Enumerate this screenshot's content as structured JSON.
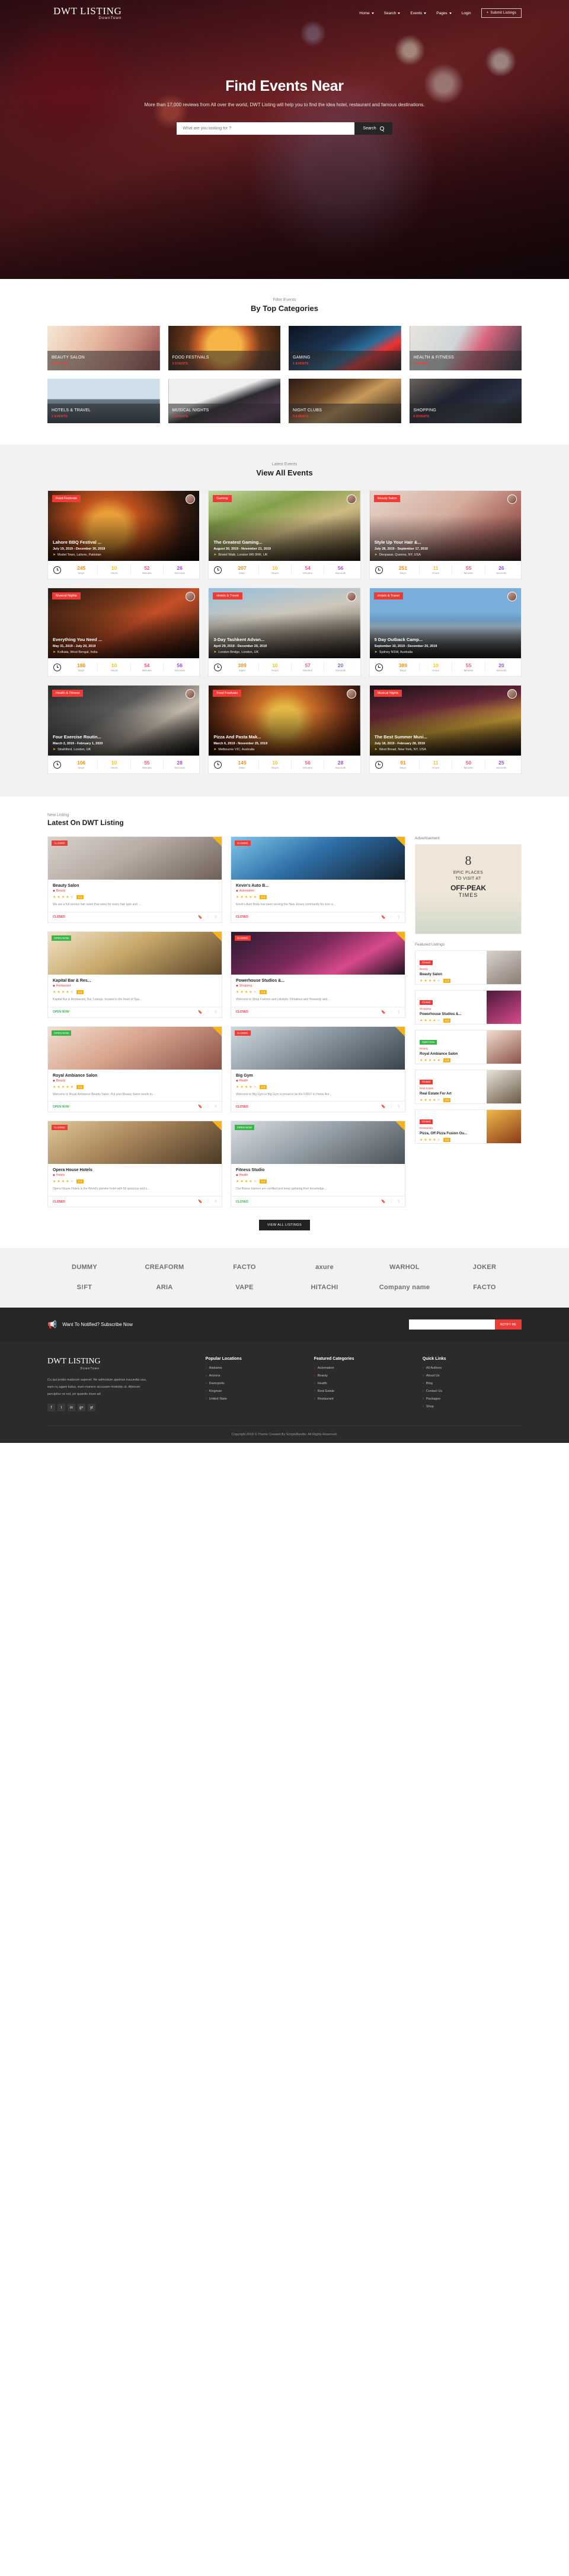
{
  "brand": {
    "title": "DWT LISTING",
    "subtitle": "DownTown",
    "accent": "#ef3b36"
  },
  "nav": {
    "items": [
      {
        "label": "Home",
        "caret": true
      },
      {
        "label": "Search",
        "caret": true
      },
      {
        "label": "Events",
        "caret": true
      },
      {
        "label": "Pages",
        "caret": true
      },
      {
        "label": "Login",
        "caret": false
      }
    ],
    "submit_label": "Submit Listings",
    "submit_icon": "plus-icon"
  },
  "hero": {
    "title": "Find Events Near",
    "subtitle": "More than 17,000 reviews from All over the world, DWT Listing will help you to find the idea hotel, restaurant and famous destinations.",
    "search_placeholder": "What are you looking for ?",
    "search_button": "Search",
    "search_icon": "search-icon"
  },
  "categories": {
    "sub": "Filter Events",
    "title": "By Top Categories",
    "items": [
      {
        "name": "BEAUTY SALON",
        "count": "1 EVENTS",
        "img": "c1"
      },
      {
        "name": "FOOD FESTIVALS",
        "count": "2 EVENTS",
        "img": "c2"
      },
      {
        "name": "GAMING",
        "count": "1 EVENTS",
        "img": "c3"
      },
      {
        "name": "HEALTH & FITNESS",
        "count": "1 EVENTS",
        "img": "c4"
      },
      {
        "name": "HOTELS & TRAVEL",
        "count": "2 EVENTS",
        "img": "c5"
      },
      {
        "name": "MUSICAL NIGHTS",
        "count": "2 EVENTS",
        "img": "c6"
      },
      {
        "name": "NIGHT CLUBS",
        "count": "0 EVENTS",
        "img": "c7"
      },
      {
        "name": "SHOPPING",
        "count": "0 EVENTS",
        "img": "c8"
      }
    ]
  },
  "events": {
    "sub": "Latest Events",
    "title": "View All Events",
    "labels": {
      "days": "Days",
      "hours": "Hours",
      "minutes": "Minutes",
      "seconds": "Seconds"
    },
    "items": [
      {
        "tag": "Food Festivals",
        "title": "Lahore BBQ Festival ...",
        "date": "July 19, 2019 - December 30, 2019",
        "loc": "Model Town, Lahore, Pakistan",
        "days": "245",
        "hours": "10",
        "minutes": "52",
        "seconds": "26",
        "img": "m1"
      },
      {
        "tag": "Gaming",
        "title": "The Greatest Gaming...",
        "date": "August 30, 2019 - November 21, 2019",
        "loc": "Bristol Walk, London W6 0RR, UK",
        "days": "207",
        "hours": "10",
        "minutes": "54",
        "seconds": "56",
        "img": "m2"
      },
      {
        "tag": "Beauty Salon",
        "title": "Style Up Your Hair &...",
        "date": "July 28, 2019 - September 17, 2019",
        "loc": "Denpasar, Queens, NY, USA",
        "days": "251",
        "hours": "11",
        "minutes": "55",
        "seconds": "26",
        "img": "m3"
      },
      {
        "tag": "Musical Nights",
        "title": "Everything You Need ...",
        "date": "May 31, 2019 - July 20, 2019",
        "loc": "Kolkata, West Bengal, India",
        "days": "180",
        "hours": "10",
        "minutes": "54",
        "seconds": "56",
        "img": "m4"
      },
      {
        "tag": "Hotels & Travel",
        "title": "3-Day Tashkent Advan...",
        "date": "April 29, 2019 - December 20, 2019",
        "loc": "London Bridge, London, UK",
        "days": "389",
        "hours": "10",
        "minutes": "57",
        "seconds": "20",
        "img": "m5"
      },
      {
        "tag": "Hotels & Travel",
        "title": "5 Day Outback Camp...",
        "date": "September 10, 2019 - December 20, 2019",
        "loc": "Sydney NSW, Australia",
        "days": "389",
        "hours": "10",
        "minutes": "55",
        "seconds": "20",
        "img": "m6"
      },
      {
        "tag": "Health & Fitness",
        "title": "Four Exercise Routin...",
        "date": "March 2, 2019 - February 1, 2020",
        "loc": "Strathford, London, UK",
        "days": "106",
        "hours": "10",
        "minutes": "55",
        "seconds": "28",
        "img": "m7"
      },
      {
        "tag": "Food Festivals",
        "title": "Pizza And Pasta Mak...",
        "date": "March 6, 2019 - November 25, 2019",
        "loc": "Melbourne VIC, Australia",
        "days": "145",
        "hours": "10",
        "minutes": "56",
        "seconds": "28",
        "img": "m8"
      },
      {
        "tag": "Musical Nights",
        "title": "The Best Summer Musi...",
        "date": "July 18, 2019 - February 28, 2019",
        "loc": "West Broad, New York, NY, USA",
        "days": "91",
        "hours": "11",
        "minutes": "50",
        "seconds": "25",
        "img": "m9"
      }
    ]
  },
  "latest": {
    "sub": "New Listing",
    "title": "Latest On DWT Listing",
    "ad_head": "Advertisement",
    "featured_head": "Featured Listings",
    "view_all": "VIEW ALL LISTINGS",
    "cards": [
      {
        "badge": "CLOSED",
        "badge_type": "closed",
        "title": "Beauty Salon",
        "cat": "Beauty",
        "desc": "We are a full service hair salon that cares for every hair type and ...",
        "rating": "4.3",
        "stars": 4,
        "status": "CLOSED",
        "img": "l1"
      },
      {
        "badge": "CLOSED",
        "badge_type": "closed",
        "title": "Kevin's Auto B...",
        "cat": "Automation",
        "desc": "Kevin's Auto Body has been serving the New Jersey community for over a...",
        "rating": "5.0",
        "stars": 5,
        "status": "CLOSED",
        "img": "l2"
      },
      {
        "badge": "OPEN NOW",
        "badge_type": "open",
        "title": "Kapital Bar & Res...",
        "cat": "Restaurant",
        "desc": "Kapital Bar & Restaurant, Bar, Lounge, located in the heart of Spa...",
        "rating": "4.0",
        "stars": 4,
        "status": "OPEN NOW",
        "img": "l3"
      },
      {
        "badge": "CLOSED",
        "badge_type": "closed",
        "title": "Powerhouse Studios &...",
        "cat": "Shopping",
        "desc": "Welcome to Shop Fashion and Lifestyle: Flirtatious and Heavenly and...",
        "rating": "4.5",
        "stars": 4,
        "status": "CLOSED",
        "img": "l4"
      },
      {
        "badge": "OPEN NOW",
        "badge_type": "open",
        "title": "Royal Ambiance Salon",
        "cat": "Beauty",
        "desc": "Welcome to Royal Ambiance Beauty Salon. Put your Beauty Salon needs in...",
        "rating": "4.8",
        "stars": 5,
        "status": "OPEN NOW",
        "img": "l5"
      },
      {
        "badge": "CLOSED",
        "badge_type": "closed",
        "title": "Big Gym",
        "cat": "Health",
        "desc": "Welcome to Big Gym in Big Gym is proud to be the FIRST in Home Are...",
        "rating": "4.0",
        "stars": 4,
        "status": "CLOSED",
        "img": "l6"
      },
      {
        "badge": "CLOSED",
        "badge_type": "closed",
        "title": "Opera House Hotels",
        "cat": "Hotels",
        "desc": "Opera House Hotels is the World's premier hotel with 50 spacious and s...",
        "rating": "3.8",
        "stars": 4,
        "status": "CLOSED",
        "img": "l7"
      },
      {
        "badge": "OPEN NOW",
        "badge_type": "open",
        "title": "Fitness Studio",
        "cat": "Health",
        "desc": "Our fitness trainers are certified and keep updating their knowledge...",
        "rating": "4.5",
        "stars": 4,
        "status": "CLOSED",
        "img": "l8"
      }
    ],
    "ad": {
      "num": "8",
      "l1": "EPIC PLACES",
      "l2": "TO VISIT AT",
      "l3": "OFF-PEAK",
      "l4": "TIMES"
    },
    "featured": [
      {
        "badge": "Closed",
        "badge_type": "closed",
        "title": "Beauty Salon",
        "cat": "Beauty",
        "stars": 4,
        "rating": "4.3",
        "img": "f1"
      },
      {
        "badge": "Closed",
        "badge_type": "closed",
        "title": "Powerhouse Studios &...",
        "cat": "Shopping",
        "stars": 4,
        "rating": "4.5",
        "img": "f2"
      },
      {
        "badge": "Open Now",
        "badge_type": "open",
        "title": "Royal Ambiance Salon",
        "cat": "Beauty",
        "stars": 5,
        "rating": "4.8",
        "img": "f3"
      },
      {
        "badge": "Closed",
        "badge_type": "closed",
        "title": "Real Estate For Art",
        "cat": "Real Estate",
        "stars": 4,
        "rating": "4.0",
        "img": "f4"
      },
      {
        "badge": "Closed",
        "badge_type": "closed",
        "title": "Pizza, Off Pizza Fusion Ou...",
        "cat": "Restaurant",
        "stars": 4,
        "rating": "4.2",
        "img": "f5"
      }
    ]
  },
  "brands": {
    "row1": [
      {
        "name": "DUMMY",
        "icon": "bulb-icon"
      },
      {
        "name": "CREAFORM",
        "icon": ""
      },
      {
        "name": "FACTO",
        "icon": "box-icon"
      },
      {
        "name": "axure",
        "icon": ""
      },
      {
        "name": "WARHOL",
        "icon": "glasses-icon"
      },
      {
        "name": "JOKER",
        "icon": ""
      }
    ],
    "row2": [
      {
        "name": "S!FT",
        "icon": ""
      },
      {
        "name": "ARIA",
        "icon": ""
      },
      {
        "name": "VAPE",
        "icon": ""
      },
      {
        "name": "HITACHI",
        "icon": "leaf-icon"
      },
      {
        "name": "Company name",
        "icon": "circle-icon"
      },
      {
        "name": "FACTO",
        "icon": "box-icon"
      }
    ]
  },
  "subscribe": {
    "icon": "megaphone-icon",
    "text": "Want To Notified? Subscribe Now",
    "placeholder": "",
    "button": "NOTIFY ME"
  },
  "footer": {
    "brand_title": "DWT LISTING",
    "brand_sub": "DownTown",
    "desc": "Cu qui probo malorum saperet. Ne admodum apeirian iracundia usu, eam cu agam ludus, eum munere accusam molestie ut. Alienum percipitur ne est, pri quando iriure ad.",
    "socials": [
      "f",
      "t",
      "in",
      "g+",
      "yt"
    ],
    "cols": [
      {
        "head": "Popular Locations",
        "items": [
          "Alabama",
          "Arizona",
          "Damopolis",
          "Kingman",
          "United State"
        ]
      },
      {
        "head": "Featured Categories",
        "items": [
          "Automation",
          "Beauty",
          "Health",
          "Real Estate",
          "Restaurant"
        ]
      },
      {
        "head": "Quick Links",
        "items": [
          "All Authors",
          "About Us",
          "Blog",
          "Contact Us",
          "Packages",
          "Shop"
        ]
      }
    ],
    "copyright": "Copyright 2018 © Theme Created By ScriptsBundle. All Rights Reserved."
  }
}
